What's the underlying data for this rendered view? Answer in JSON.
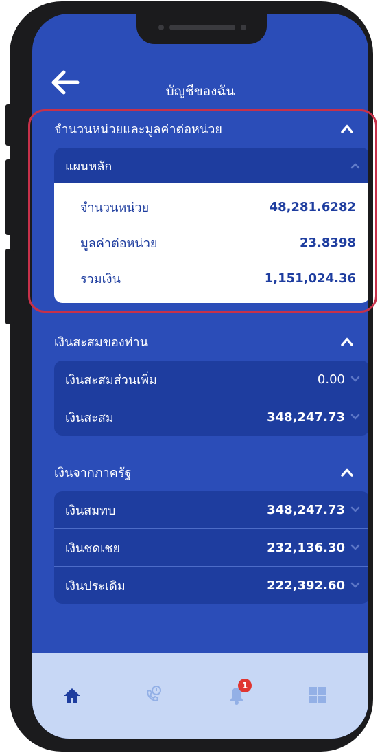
{
  "header": {
    "title": "บัญชีของฉัน"
  },
  "units_section": {
    "title": "จำนวนหน่วยและมูลค่าต่อหน่วย",
    "plan": {
      "title": "แผนหลัก",
      "rows": [
        {
          "label": "จำนวนหน่วย",
          "value": "48,281.6282"
        },
        {
          "label": "มูลค่าต่อหน่วย",
          "value": "23.8398"
        },
        {
          "label": "รวมเงิน",
          "value": "1,151,024.36"
        }
      ]
    }
  },
  "savings_section": {
    "title": "เงินสะสมของท่าน",
    "rows": [
      {
        "label": "เงินสะสมส่วนเพิ่ม",
        "value": "0.00"
      },
      {
        "label": "เงินสะสม",
        "value": "348,247.73"
      }
    ]
  },
  "gov_section": {
    "title": "เงินจากภาครัฐ",
    "rows": [
      {
        "label": "เงินสมทบ",
        "value": "348,247.73"
      },
      {
        "label": "เงินชดเชย",
        "value": "232,136.30"
      },
      {
        "label": "เงินประเดิม",
        "value": "222,392.60"
      }
    ]
  },
  "bottom_nav": {
    "items": [
      {
        "icon": "home-icon"
      },
      {
        "icon": "phone-info-icon"
      },
      {
        "icon": "bell-icon",
        "badge": "1"
      },
      {
        "icon": "grid-menu-icon"
      }
    ]
  },
  "colors": {
    "screen_bg": "#2b4db8",
    "card_bg": "#1e3d9f",
    "highlight": "#c7314a",
    "nav_bg": "#c7d7f5",
    "badge": "#e03530"
  }
}
